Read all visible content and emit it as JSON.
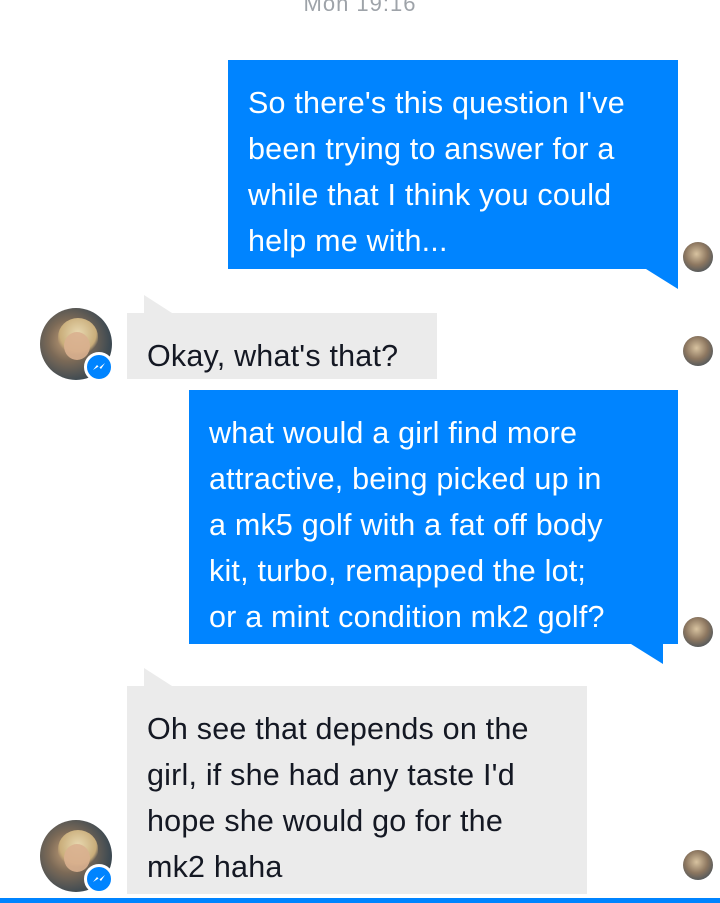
{
  "conversation": {
    "timestamp": "Mon 19:16",
    "messages": [
      {
        "direction": "sent",
        "lines": [
          "So there's this question I've",
          "been trying to answer for a",
          "while that I think you could",
          "help me with..."
        ]
      },
      {
        "direction": "received",
        "lines": [
          "Okay, what's that?"
        ]
      },
      {
        "direction": "sent",
        "lines": [
          "what would a girl find more",
          "attractive, being picked up in",
          "a mk5 golf with a fat off body",
          "kit, turbo, remapped the lot;",
          "or a mint condition mk2 golf?"
        ]
      },
      {
        "direction": "received",
        "lines": [
          "Oh see that depends on the",
          "girl, if she had any taste I'd",
          "hope she would go for the",
          "mk2 haha"
        ]
      }
    ]
  },
  "colors": {
    "sent_bubble": "#0084ff",
    "received_bubble": "#ebebeb",
    "messenger_badge": "#0084ff",
    "timestamp_text": "#9ea3a9"
  },
  "icons": {
    "contact_avatar": "contact-avatar",
    "messenger_badge": "messenger-bolt-icon",
    "read_receipt": "seen-avatar-icon"
  }
}
